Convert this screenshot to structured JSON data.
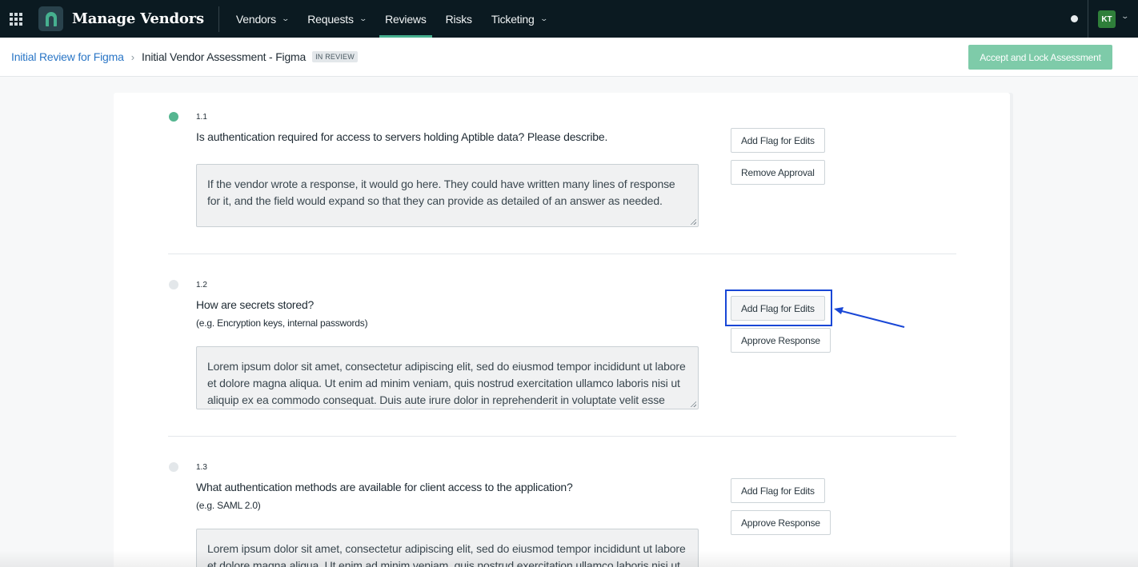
{
  "app": {
    "title": "Manage Vendors"
  },
  "nav": {
    "items": [
      {
        "label": "Vendors",
        "dropdown": true
      },
      {
        "label": "Requests",
        "dropdown": true
      },
      {
        "label": "Reviews",
        "dropdown": false,
        "active": true
      },
      {
        "label": "Risks",
        "dropdown": false
      },
      {
        "label": "Ticketing",
        "dropdown": true
      }
    ],
    "user_initials": "KT"
  },
  "breadcrumb": {
    "parent": "Initial Review for Figma",
    "current": "Initial Vendor Assessment - Figma",
    "status_badge": "IN REVIEW"
  },
  "actions": {
    "lock_label": "Accept and Lock Assessment"
  },
  "questions": [
    {
      "number": "1.1",
      "text": "Is authentication required for access to servers holding Aptible data? Please describe.",
      "hint": "",
      "status": "approved",
      "answer": "If the vendor wrote a response, it would go here. They could have written many lines of response for it, and the field would expand so that they can provide as detailed of an answer as needed.",
      "buttons": [
        "Add Flag for Edits",
        "Remove Approval"
      ]
    },
    {
      "number": "1.2",
      "text": "How are secrets stored?",
      "hint": "(e.g. Encryption keys, internal passwords)",
      "status": "pending",
      "answer": "Lorem ipsum dolor sit amet, consectetur adipiscing elit, sed do eiusmod tempor incididunt ut labore et dolore magna aliqua. Ut enim ad minim veniam, quis nostrud exercitation ullamco laboris nisi ut aliquip ex ea commodo consequat. Duis aute irure dolor in reprehenderit in voluptate velit esse cillum dolore",
      "buttons": [
        "Add Flag for Edits",
        "Approve Response"
      ]
    },
    {
      "number": "1.3",
      "text": "What authentication methods are available for client access to the application?",
      "hint": "(e.g. SAML 2.0)",
      "status": "pending",
      "answer": "Lorem ipsum dolor sit amet, consectetur adipiscing elit, sed do eiusmod tempor incididunt ut labore et dolore magna aliqua. Ut enim ad minim veniam, quis nostrud exercitation ullamco laboris nisi ut aliquip",
      "buttons": [
        "Add Flag for Edits",
        "Approve Response"
      ]
    }
  ],
  "colors": {
    "nav_bg": "#0b1a21",
    "accent_green": "#46b08f",
    "lock_button": "#7ecba9",
    "link_blue": "#2a76c6",
    "annotation_blue": "#1947d6"
  }
}
